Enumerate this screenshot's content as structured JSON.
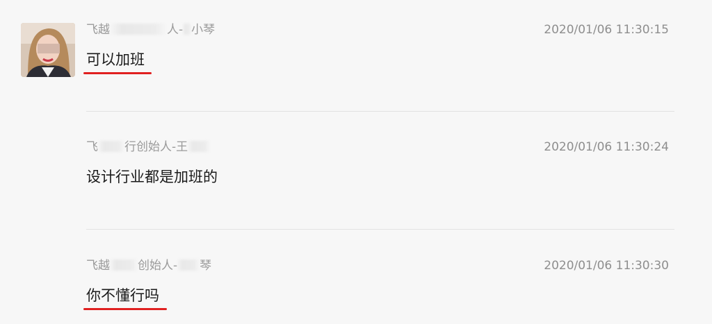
{
  "messages": [
    {
      "sender_prefix": "飞越",
      "sender_middle": "人-",
      "sender_suffix": "小琴",
      "time": "2020/01/06 11:30:15",
      "text": "可以加班",
      "highlighted": true
    },
    {
      "sender_prefix": "飞",
      "sender_middle": "行创始人-王",
      "sender_suffix": "",
      "time": "2020/01/06 11:30:24",
      "text": "设计行业都是加班的",
      "highlighted": false
    },
    {
      "sender_prefix": "飞越",
      "sender_middle": "创始人-",
      "sender_suffix": "琴",
      "time": "2020/01/06 11:30:30",
      "text": "你不懂行吗",
      "highlighted": true
    }
  ],
  "colors": {
    "background": "#f7f7f7",
    "highlight_underline": "#e02020",
    "meta_text": "#9a9a9a",
    "message_text": "#1a1a1a"
  },
  "icons": {
    "avatar": "user-photo-avatar"
  }
}
